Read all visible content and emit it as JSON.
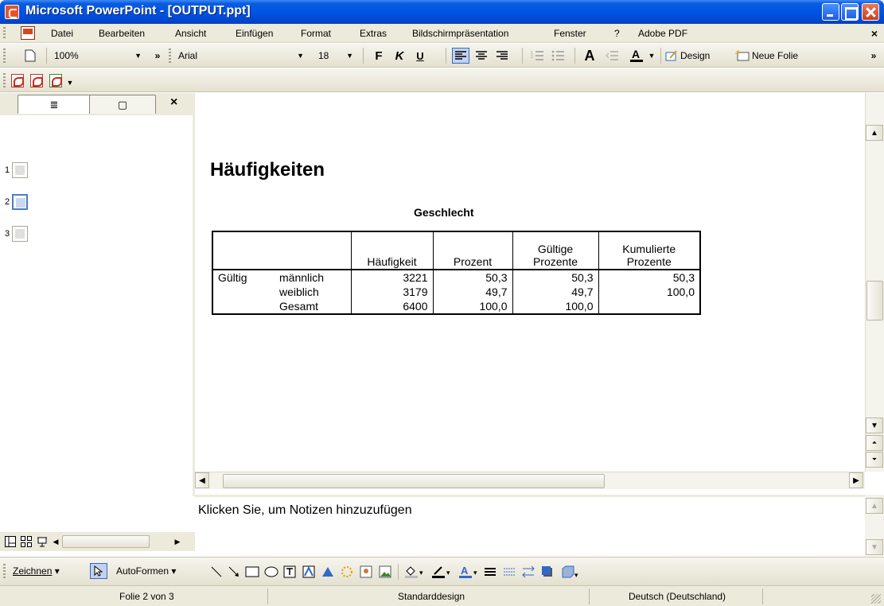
{
  "window": {
    "title": "Microsoft PowerPoint - [OUTPUT.ppt]"
  },
  "menu": {
    "items": [
      "Datei",
      "Bearbeiten",
      "Ansicht",
      "Einfügen",
      "Format",
      "Extras",
      "Bildschirmpräsentation",
      "Fenster",
      "?",
      "Adobe PDF"
    ],
    "close_symbol": "×"
  },
  "toolbar": {
    "zoom": "100%",
    "font": "Arial",
    "font_size": "18",
    "bold": "F",
    "italic": "K",
    "underline": "U",
    "design_label": "Design",
    "new_slide_label": "Neue Folie"
  },
  "left_panel": {
    "tab_outline_symbol": "≣",
    "tab_slides_symbol": "▢",
    "close_symbol": "×",
    "slides": [
      {
        "number": "1",
        "selected": false
      },
      {
        "number": "2",
        "selected": true
      },
      {
        "number": "3",
        "selected": false
      }
    ]
  },
  "slide": {
    "title": "Häufigkeiten",
    "table_title": "Geschlecht",
    "columns": [
      "",
      "",
      "Häufigkeit",
      "Prozent",
      "Gültige Prozente",
      "Kumulierte Prozente"
    ],
    "rows": [
      {
        "group": "Gültig",
        "label": "männlich",
        "freq": "3221",
        "pct": "50,3",
        "valid_pct": "50,3",
        "cum_pct": "50,3"
      },
      {
        "group": "",
        "label": "weiblich",
        "freq": "3179",
        "pct": "49,7",
        "valid_pct": "49,7",
        "cum_pct": "100,0"
      },
      {
        "group": "",
        "label": "Gesamt",
        "freq": "6400",
        "pct": "100,0",
        "valid_pct": "100,0",
        "cum_pct": ""
      }
    ]
  },
  "notes": {
    "placeholder": "Klicken Sie, um Notizen hinzuzufügen"
  },
  "drawing_toolbar": {
    "draw_label": "Zeichnen",
    "autoshapes_label": "AutoFormen"
  },
  "status": {
    "slide_info": "Folie 2 von 3",
    "design": "Standarddesign",
    "language": "Deutsch (Deutschland)"
  }
}
